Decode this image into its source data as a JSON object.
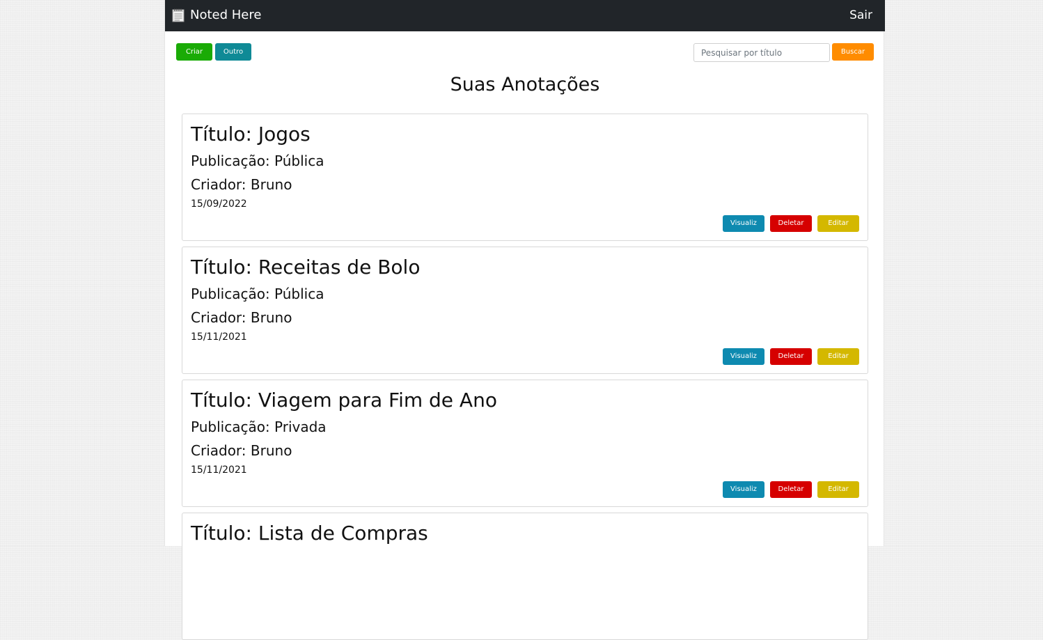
{
  "navbar": {
    "brand": "Noted Here",
    "logout_label": "Sair"
  },
  "toolbar": {
    "create_label": "Criar",
    "other_label": "Outro",
    "search_placeholder": "Pesquisar por título",
    "search_label": "Buscar"
  },
  "heading": "Suas Anotações",
  "colors": {
    "navbar": "#212529",
    "create": "#1aab06",
    "other": "#0f8a96",
    "search": "#ff8c00",
    "view": "#0e8ab0",
    "delete": "#d60000",
    "edit": "#d4b800"
  },
  "notes": [
    {
      "title": "Título: Jogos",
      "publication": "Publicação: Pública",
      "creator": "Criador: Bruno",
      "date": "15/09/2022",
      "view_label": "Visualiz",
      "delete_label": "Deletar",
      "edit_label": "Editar"
    },
    {
      "title": "Título: Receitas de Bolo",
      "publication": "Publicação: Pública",
      "creator": "Criador: Bruno",
      "date": "15/11/2021",
      "view_label": "Visualiz",
      "delete_label": "Deletar",
      "edit_label": "Editar"
    },
    {
      "title": "Título: Viagem para Fim de Ano",
      "publication": "Publicação: Privada",
      "creator": "Criador: Bruno",
      "date": "15/11/2021",
      "view_label": "Visualiz",
      "delete_label": "Deletar",
      "edit_label": "Editar"
    },
    {
      "title": "Título: Lista de Compras"
    }
  ]
}
